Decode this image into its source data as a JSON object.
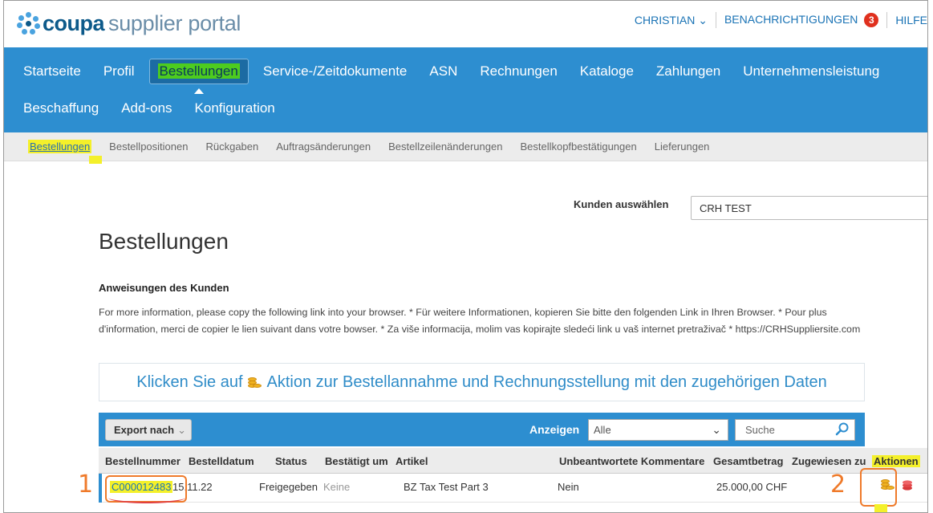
{
  "brand": {
    "word": "coupa",
    "rest": "supplier portal"
  },
  "user_nav": {
    "user": "CHRISTIAN ⌄",
    "notifications": "BENACHRICHTIGUNGEN",
    "notification_count": "3",
    "help": "HILFE"
  },
  "main_nav": {
    "row1": [
      "Startseite",
      "Profil",
      "Bestellungen",
      "Service-/Zeitdokumente",
      "ASN",
      "Rechnungen",
      "Kataloge",
      "Zahlungen",
      "Unternehmensleistung"
    ],
    "row2": [
      "Beschaffung",
      "Add-ons",
      "Konfiguration"
    ]
  },
  "sub_nav": [
    "Bestellungen",
    "Bestellpositionen",
    "Rückgaben",
    "Auftragsänderungen",
    "Bestellzeilenänderungen",
    "Bestellkopfbestätigungen",
    "Lieferungen"
  ],
  "customer": {
    "label": "Kunden auswählen",
    "value": "CRH TEST"
  },
  "page_title": "Bestellungen",
  "instructions": {
    "title": "Anweisungen des Kunden",
    "text": "For more information, please copy the following link into your browser. * Für weitere Informationen, kopieren Sie bitte den folgenden Link in Ihren Browser. * Pour plus d'information, merci de copier le lien suivant dans votre bowser. * Za više informacija, molim vas kopirajte sledeći link u vaš internet pretraživač * https://CRHSuppliersite.com"
  },
  "banner": {
    "before": "Klicken Sie auf",
    "after": "Aktion zur Bestellannahme und Rechnungsstellung mit den zugehörigen Daten"
  },
  "toolbar": {
    "export_label": "Export nach",
    "show_label": "Anzeigen",
    "show_value": "Alle",
    "search_placeholder": "Suche"
  },
  "table": {
    "headers": [
      "Bestellnummer",
      "Bestelldatum",
      "Status",
      "Bestätigt um",
      "Artikel",
      "Unbeantwortete Kommentare",
      "Gesamtbetrag",
      "Zugewiesen zu",
      "Aktionen"
    ],
    "rows": [
      {
        "order": "C000012483",
        "date": "15.11.22",
        "status": "Freigegeben",
        "confirmed": "Keine",
        "item": "BZ Tax Test Part 3",
        "comments": "Nein",
        "total": "25.000,00 CHF",
        "assigned": ""
      }
    ]
  },
  "annotations": {
    "one": "1",
    "two": "2"
  },
  "colors": {
    "nav_blue": "#2d8ed0",
    "highlight_yellow": "#f4f02a",
    "highlight_green": "#4dcc1f",
    "annotation_orange": "#ef7a2a"
  },
  "icons": {
    "brand": "coupa-burst-icon",
    "action_invoice": "coins-icon",
    "action_other": "coin-stack-icon",
    "search": "search-icon"
  }
}
